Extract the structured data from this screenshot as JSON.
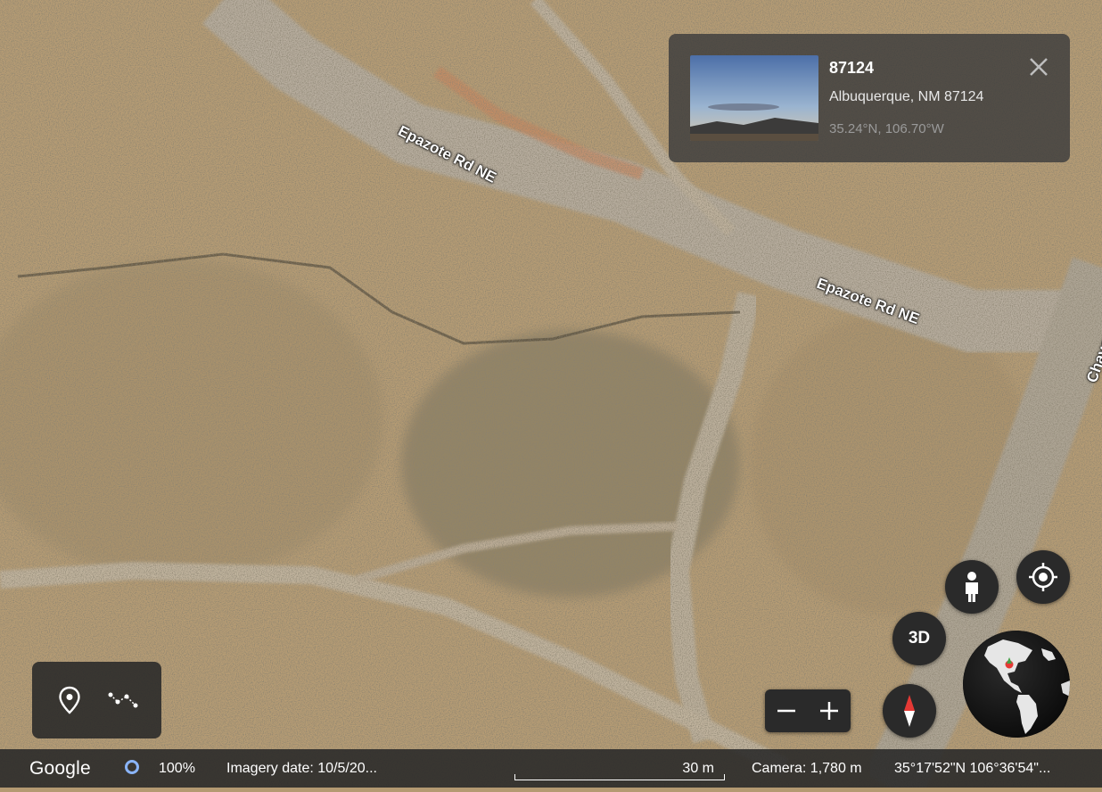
{
  "map": {
    "road_labels": [
      "Epazote Rd NE",
      "Epazote Rd NE",
      "Chavez"
    ]
  },
  "info_card": {
    "title": "87124",
    "address": "Albuquerque, NM 87124",
    "coordinates": "35.24°N, 106.70°W",
    "close_icon": "close-icon"
  },
  "tools": {
    "placemark_icon": "location-pin-icon",
    "path_icon": "path-measure-icon"
  },
  "controls": {
    "pegman_icon": "street-view-person-icon",
    "my_location_icon": "my-location-icon",
    "view_3d_label": "3D",
    "zoom_out_label": "−",
    "zoom_in_label": "+",
    "compass_icon": "compass-icon",
    "globe_icon": "globe-icon"
  },
  "status_bar": {
    "logo": "Google",
    "loading_percent": "100%",
    "imagery_date": "Imagery date: 10/5/20...",
    "scale": "30 m",
    "camera": "Camera: 1,780 m",
    "coordinates": "35°17'52\"N 106°36'54\"..."
  },
  "colors": {
    "terrain": "#b49a72",
    "road": "#b3a99a",
    "panel_bg": "#2a2a2a",
    "accent_blue": "#8ab4f8",
    "compass_red": "#e53935"
  }
}
